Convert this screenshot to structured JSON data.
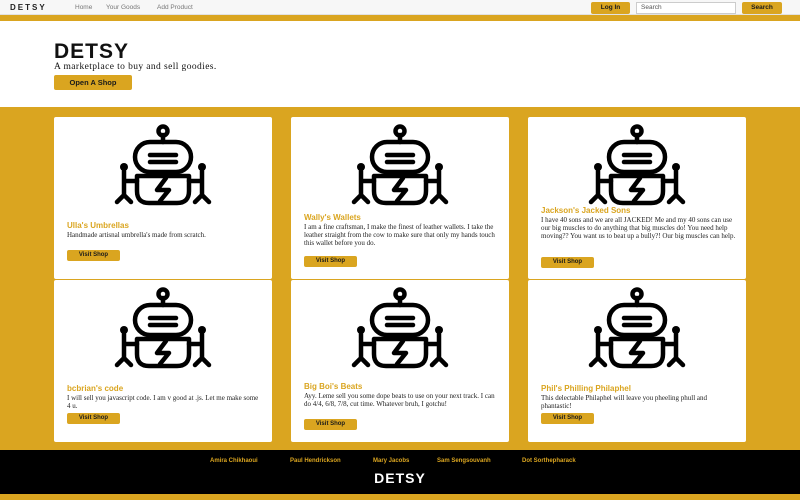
{
  "nav": {
    "brand": "DETSY",
    "links": [
      "Home",
      "Your Goods",
      "Add Product"
    ],
    "login_label": "Log In",
    "search_placeholder": "Search",
    "search_label": "Search"
  },
  "hero": {
    "title": "DETSY",
    "subtitle": "A marketplace to buy and sell goodies.",
    "cta_label": "Open A Shop"
  },
  "shops": [
    {
      "title": "Ulla's Umbrellas",
      "description": "Handmade artisnal umbrella's made from scratch.",
      "button": "Visit Shop",
      "icon": "robot-icon"
    },
    {
      "title": "Wally's Wallets",
      "description": "I am a fine craftsman, I make the finest of leather wallets. I take the leather straight from the cow to make sure that only my hands touch this wallet before you do.",
      "button": "Visit Shop",
      "icon": "robot-icon"
    },
    {
      "title": "Jackson's Jacked Sons",
      "description": "I have 40 sons and we are all JACKED! Me and my 40 sons can use our big muscles to do anything that big muscles do! You need help moving?? You want us to beat up a bully?! Our big muscles can help.",
      "button": "Visit Shop",
      "icon": "robot-icon"
    },
    {
      "title": "bcbrian's code",
      "description": "I will sell you javascript code. I am v good at .js. Let me make some 4 u.",
      "button": "Visit Shop",
      "icon": "robot-icon"
    },
    {
      "title": "Big Boi's Beats",
      "description": "Ayy. Leme sell you some dope beats to use on your next track. I can do 4/4, 6/8, 7/8, cut time. Whatever bruh, I gotchu!",
      "button": "Visit Shop",
      "icon": "robot-icon"
    },
    {
      "title": "Phil's Philling Philaphel",
      "description": "This delectable Philaphel will leave you pheeling phull and phantastic!",
      "button": "Visit Shop",
      "icon": "robot-icon"
    }
  ],
  "footer": {
    "names": [
      "Amira Chikhaoui",
      "Paul Hendrickson",
      "Mary Jacobs",
      "Sam Sengsouvanh",
      "Dot Sorthepharack"
    ],
    "brand": "DETSY"
  },
  "colors": {
    "accent": "#daa520",
    "footer_bg": "#000000"
  }
}
